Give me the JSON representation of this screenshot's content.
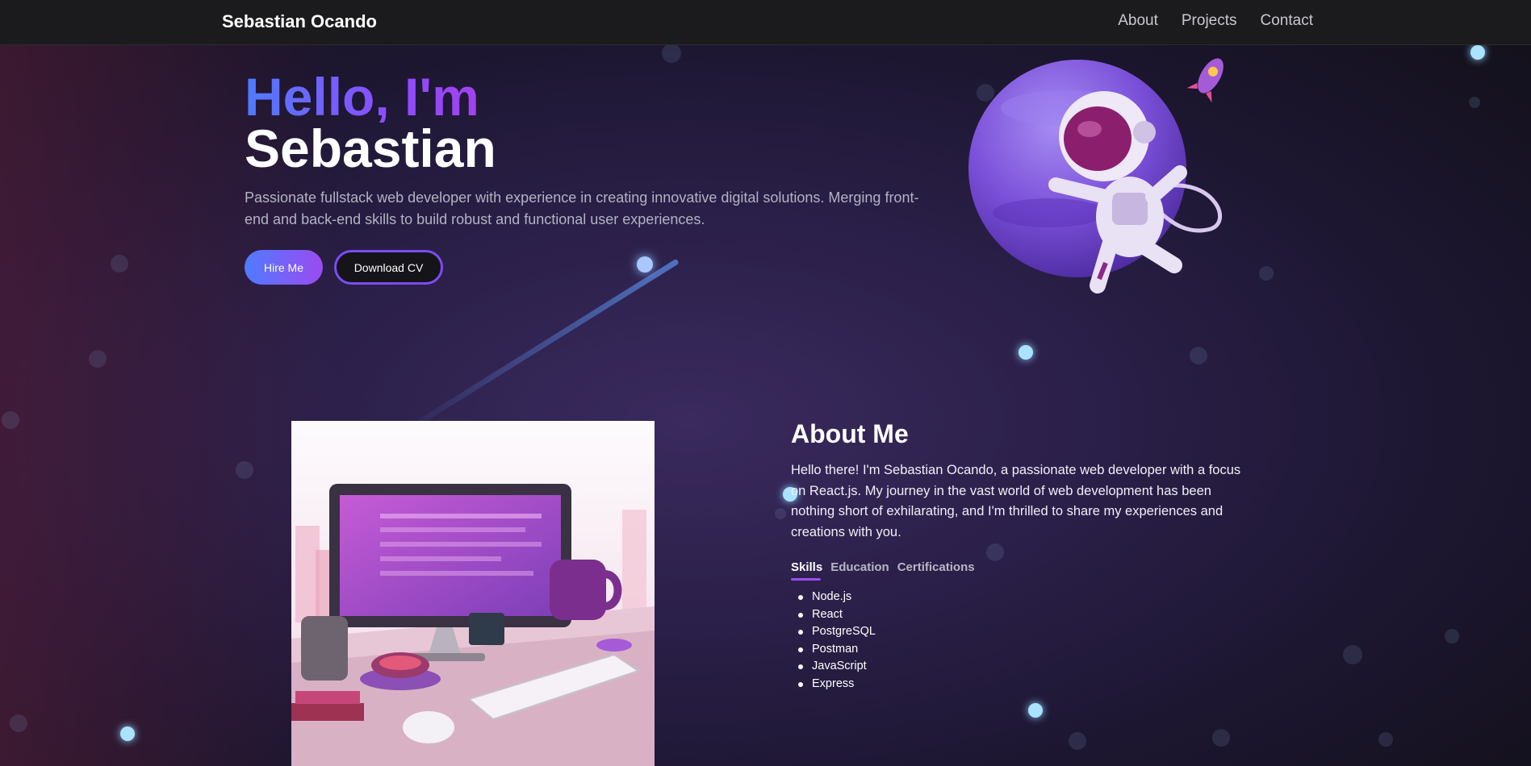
{
  "nav": {
    "brand": "Sebastian Ocando",
    "links": [
      {
        "label": "About"
      },
      {
        "label": "Projects"
      },
      {
        "label": "Contact"
      }
    ]
  },
  "hero": {
    "greeting": "Hello, I'm",
    "name": "Sebastian",
    "description": "Passionate fullstack web developer with experience in creating innovative digital solutions. Merging front-end and back-end skills to build robust and functional user experiences.",
    "hire_button": "Hire Me",
    "cv_button": "Download CV"
  },
  "about": {
    "title": "About Me",
    "text": "Hello there! I'm Sebastian Ocando, a passionate web developer with a focus on React.js. My journey in the vast world of web development has been nothing short of exhilarating, and I'm thrilled to share my experiences and creations with you.",
    "tabs": [
      {
        "label": "Skills",
        "active": true
      },
      {
        "label": "Education",
        "active": false
      },
      {
        "label": "Certifications",
        "active": false
      }
    ],
    "skills": [
      "Node.js",
      "React",
      "PostgreSQL",
      "Postman",
      "JavaScript",
      "Express"
    ]
  },
  "colors": {
    "accent_blue": "#4f7bff",
    "accent_purple": "#9b4bf0",
    "navbar_bg": "#1b1b1d"
  }
}
